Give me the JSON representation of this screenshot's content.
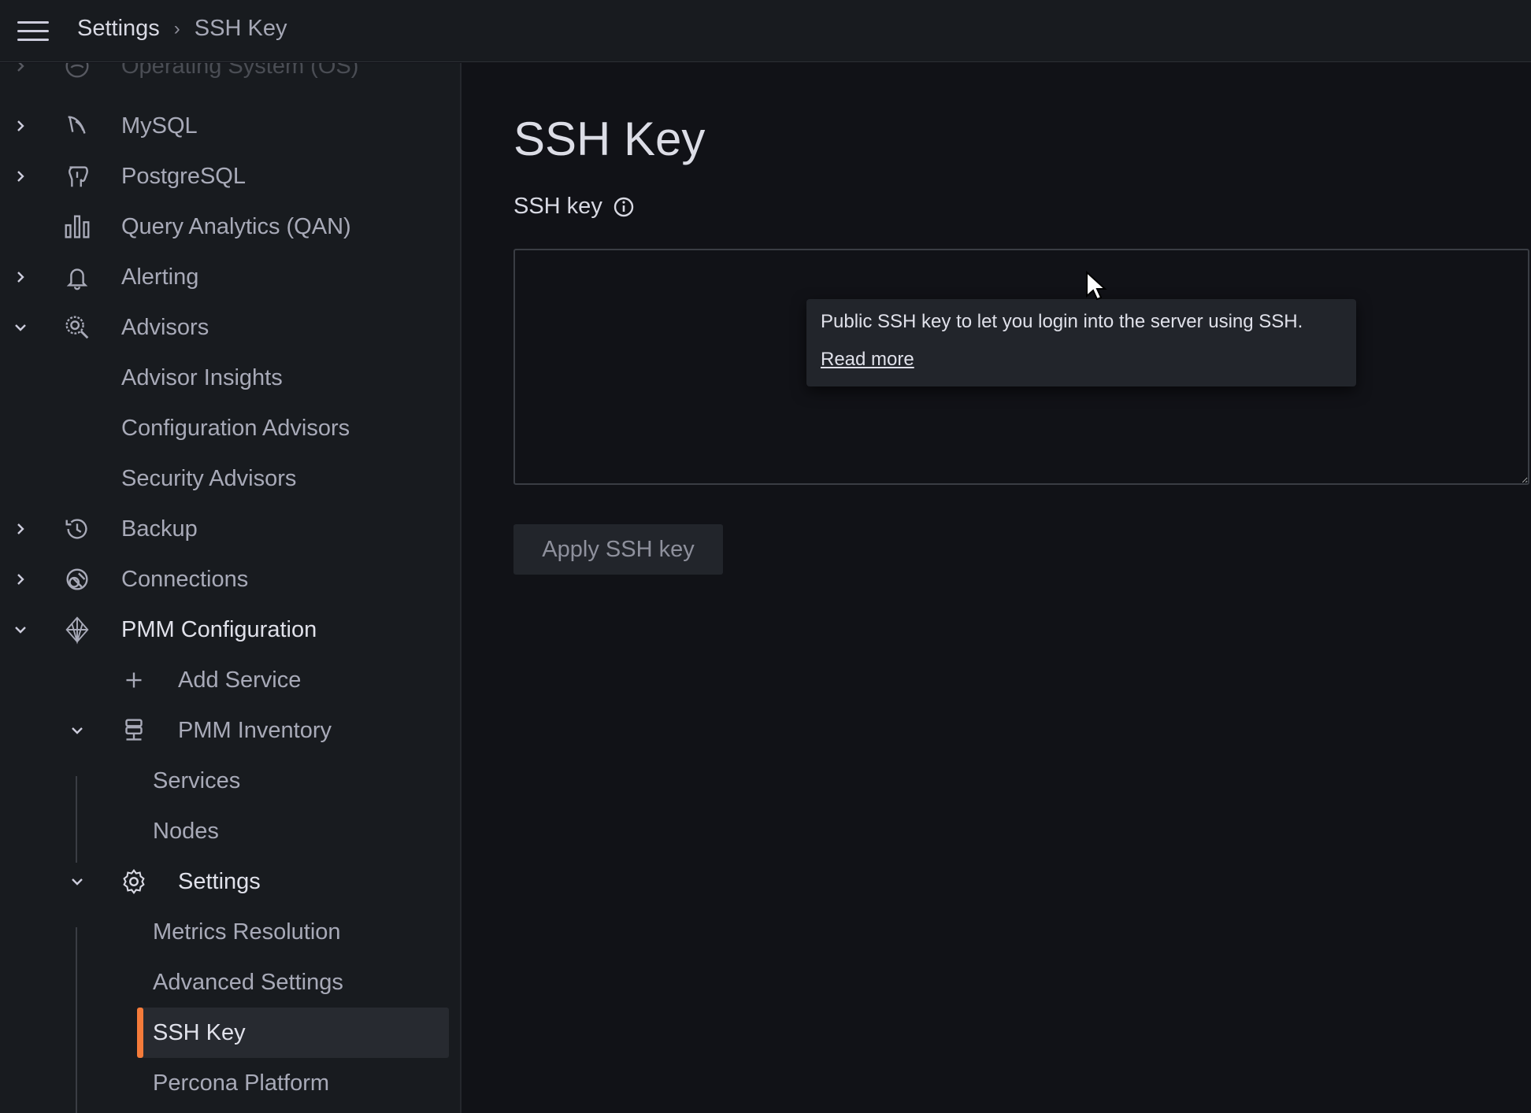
{
  "header": {
    "menu_icon": "hamburger-menu-icon",
    "breadcrumb": [
      "Settings",
      "SSH Key"
    ]
  },
  "sidebar": {
    "items": [
      {
        "label": "Operating System (OS)",
        "icon": "os-icon",
        "chevron": "right"
      },
      {
        "label": "MySQL",
        "icon": "mysql-dolphin-icon",
        "chevron": "right"
      },
      {
        "label": "PostgreSQL",
        "icon": "postgresql-elephant-icon",
        "chevron": "right"
      },
      {
        "label": "Query Analytics (QAN)",
        "icon": "bar-chart-icon"
      },
      {
        "label": "Alerting",
        "icon": "bell-icon",
        "chevron": "right"
      },
      {
        "label": "Advisors",
        "icon": "advisors-search-icon",
        "chevron": "down"
      },
      {
        "label": "Advisor Insights"
      },
      {
        "label": "Configuration Advisors"
      },
      {
        "label": "Security Advisors"
      },
      {
        "label": "Backup",
        "icon": "history-icon",
        "chevron": "right"
      },
      {
        "label": "Connections",
        "icon": "connections-icon",
        "chevron": "right"
      },
      {
        "label": "PMM Configuration",
        "icon": "pmm-logo-icon",
        "chevron": "down"
      },
      {
        "label": "Add Service",
        "icon": "plus-icon"
      },
      {
        "label": "PMM Inventory",
        "icon": "inventory-icon",
        "chevron": "down"
      },
      {
        "label": "Services"
      },
      {
        "label": "Nodes"
      },
      {
        "label": "Settings",
        "icon": "gear-icon",
        "chevron": "down"
      },
      {
        "label": "Metrics Resolution"
      },
      {
        "label": "Advanced Settings"
      },
      {
        "label": "SSH Key",
        "active": true
      },
      {
        "label": "Percona Platform"
      }
    ]
  },
  "main": {
    "title": "SSH Key",
    "field_label": "SSH key",
    "textarea_value": "",
    "apply_label": "Apply SSH key"
  },
  "tooltip": {
    "text": "Public SSH key to let you login into the server using SSH.",
    "link": "Read more"
  },
  "colors": {
    "accent": "#f47b3a",
    "background": "#111217",
    "sidebar": "#181b1f"
  }
}
